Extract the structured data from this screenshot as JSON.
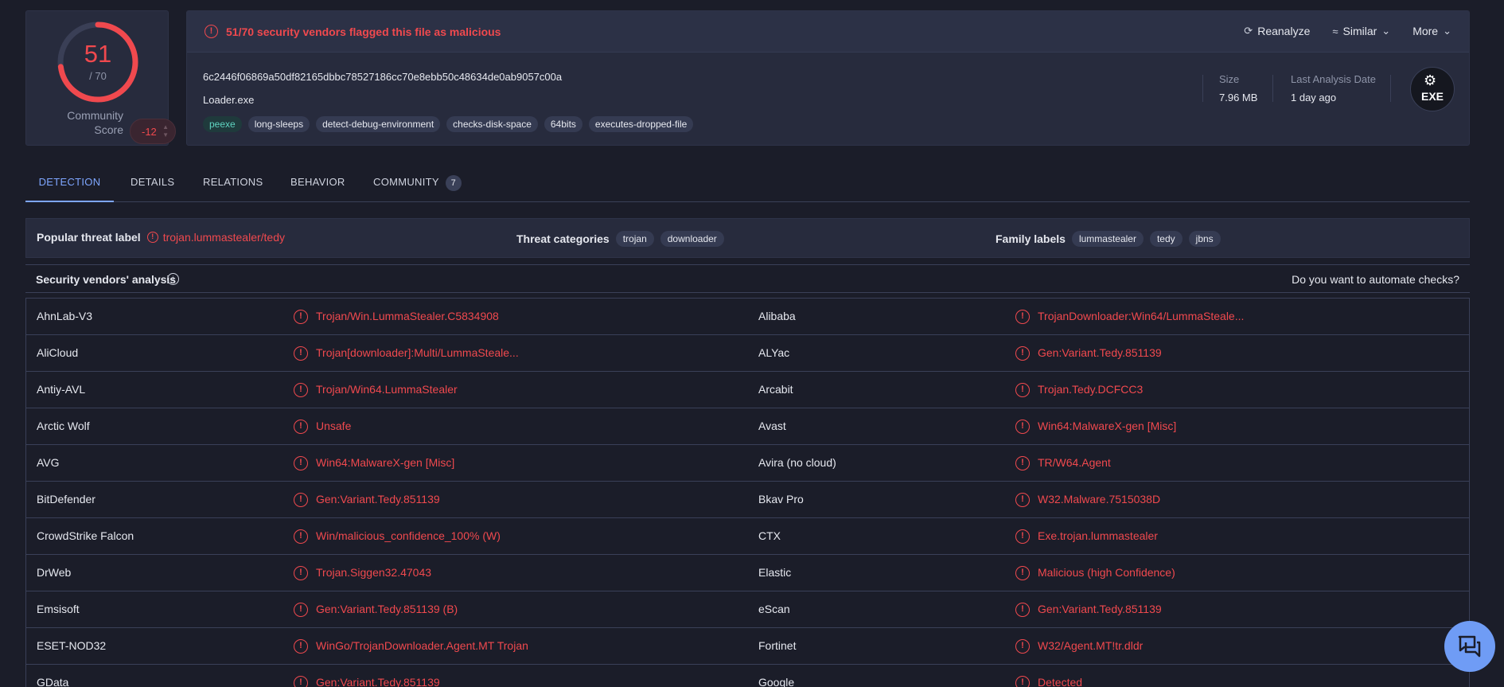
{
  "score": {
    "detected": "51",
    "total": "/ 70",
    "community_label": "Community Score",
    "community_value": "-12",
    "fraction": 0.7286
  },
  "alert": {
    "text": "51/70 security vendors flagged this file as malicious"
  },
  "actions": {
    "reanalyze": "Reanalyze",
    "similar": "Similar",
    "more": "More"
  },
  "file": {
    "hash": "6c2446f06869a50df82165dbbc78527186cc70e8ebb50c48634de0ab9057c00a",
    "name": "Loader.exe",
    "tags": [
      "peexe",
      "long-sleeps",
      "detect-debug-environment",
      "checks-disk-space",
      "64bits",
      "executes-dropped-file"
    ],
    "size_label": "Size",
    "size_value": "7.96 MB",
    "date_label": "Last Analysis Date",
    "date_value": "1 day ago",
    "type_badge": "EXE"
  },
  "tabs": [
    {
      "label": "DETECTION",
      "active": true
    },
    {
      "label": "DETAILS"
    },
    {
      "label": "RELATIONS"
    },
    {
      "label": "BEHAVIOR"
    },
    {
      "label": "COMMUNITY",
      "count": "7"
    }
  ],
  "threat": {
    "popular_label": "Popular threat label",
    "popular_value": "trojan.lummastealer/tedy",
    "categories_label": "Threat categories",
    "categories": [
      "trojan",
      "downloader"
    ],
    "family_label": "Family labels",
    "families": [
      "lummastealer",
      "tedy",
      "jbns"
    ]
  },
  "vendors_header": {
    "title": "Security vendors' analysis",
    "automate": "Do you want to automate checks?"
  },
  "vendors": [
    {
      "a": "AhnLab-V3",
      "ar": "Trojan/Win.LummaStealer.C5834908",
      "b": "Alibaba",
      "br": "TrojanDownloader:Win64/LummaSteale..."
    },
    {
      "a": "AliCloud",
      "ar": "Trojan[downloader]:Multi/LummaSteale...",
      "b": "ALYac",
      "br": "Gen:Variant.Tedy.851139"
    },
    {
      "a": "Antiy-AVL",
      "ar": "Trojan/Win64.LummaStealer",
      "b": "Arcabit",
      "br": "Trojan.Tedy.DCFCC3"
    },
    {
      "a": "Arctic Wolf",
      "ar": "Unsafe",
      "b": "Avast",
      "br": "Win64:MalwareX-gen [Misc]"
    },
    {
      "a": "AVG",
      "ar": "Win64:MalwareX-gen [Misc]",
      "b": "Avira (no cloud)",
      "br": "TR/W64.Agent"
    },
    {
      "a": "BitDefender",
      "ar": "Gen:Variant.Tedy.851139",
      "b": "Bkav Pro",
      "br": "W32.Malware.7515038D"
    },
    {
      "a": "CrowdStrike Falcon",
      "ar": "Win/malicious_confidence_100% (W)",
      "b": "CTX",
      "br": "Exe.trojan.lummastealer"
    },
    {
      "a": "DrWeb",
      "ar": "Trojan.Siggen32.47043",
      "b": "Elastic",
      "br": "Malicious (high Confidence)"
    },
    {
      "a": "Emsisoft",
      "ar": "Gen:Variant.Tedy.851139 (B)",
      "b": "eScan",
      "br": "Gen:Variant.Tedy.851139"
    },
    {
      "a": "ESET-NOD32",
      "ar": "WinGo/TrojanDownloader.Agent.MT Trojan",
      "b": "Fortinet",
      "br": "W32/Agent.MT!tr.dldr"
    },
    {
      "a": "GData",
      "ar": "Gen:Variant.Tedy.851139",
      "b": "Google",
      "br": "Detected"
    }
  ],
  "colors": {
    "malicious": "#f0494e",
    "accent": "#7ea6ff"
  }
}
